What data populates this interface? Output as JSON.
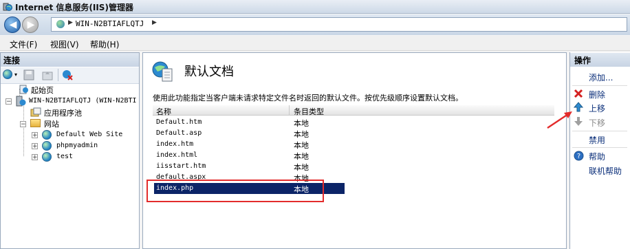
{
  "window": {
    "title": "Internet 信息服务(IIS)管理器"
  },
  "address": {
    "segments": [
      "WIN-N2BTIAFLQTJ"
    ],
    "separator": "▶"
  },
  "menu": {
    "items": [
      "文件(F)",
      "视图(V)",
      "帮助(H)"
    ]
  },
  "connections": {
    "title": "连接",
    "tree": {
      "start_page": "起始页",
      "server": "WIN-N2BTIAFLQTJ (WIN-N2BTI",
      "app_pools": "应用程序池",
      "sites": "网站",
      "site_list": [
        "Default Web Site",
        "phpmyadmin",
        "test"
      ]
    }
  },
  "feature": {
    "title": "默认文档",
    "description": "使用此功能指定当客户端未请求特定文件名时返回的默认文件。按优先级顺序设置默认文档。",
    "columns": [
      "名称",
      "条目类型"
    ],
    "rows": [
      {
        "name": "Default.htm",
        "type": "本地"
      },
      {
        "name": "Default.asp",
        "type": "本地"
      },
      {
        "name": "index.htm",
        "type": "本地"
      },
      {
        "name": "index.html",
        "type": "本地"
      },
      {
        "name": "iisstart.htm",
        "type": "本地"
      },
      {
        "name": "default.aspx",
        "type": "本地"
      },
      {
        "name": "index.php",
        "type": "本地"
      }
    ],
    "selected_index": 6
  },
  "actions": {
    "title": "操作",
    "add": "添加...",
    "remove": "删除",
    "move_up": "上移",
    "move_down": "下移",
    "disable": "禁用",
    "help": "帮助",
    "online_help": "联机帮助"
  },
  "colors": {
    "selection": "#0b2467",
    "annotation": "#e32b2b",
    "link": "#0b2f7a"
  }
}
